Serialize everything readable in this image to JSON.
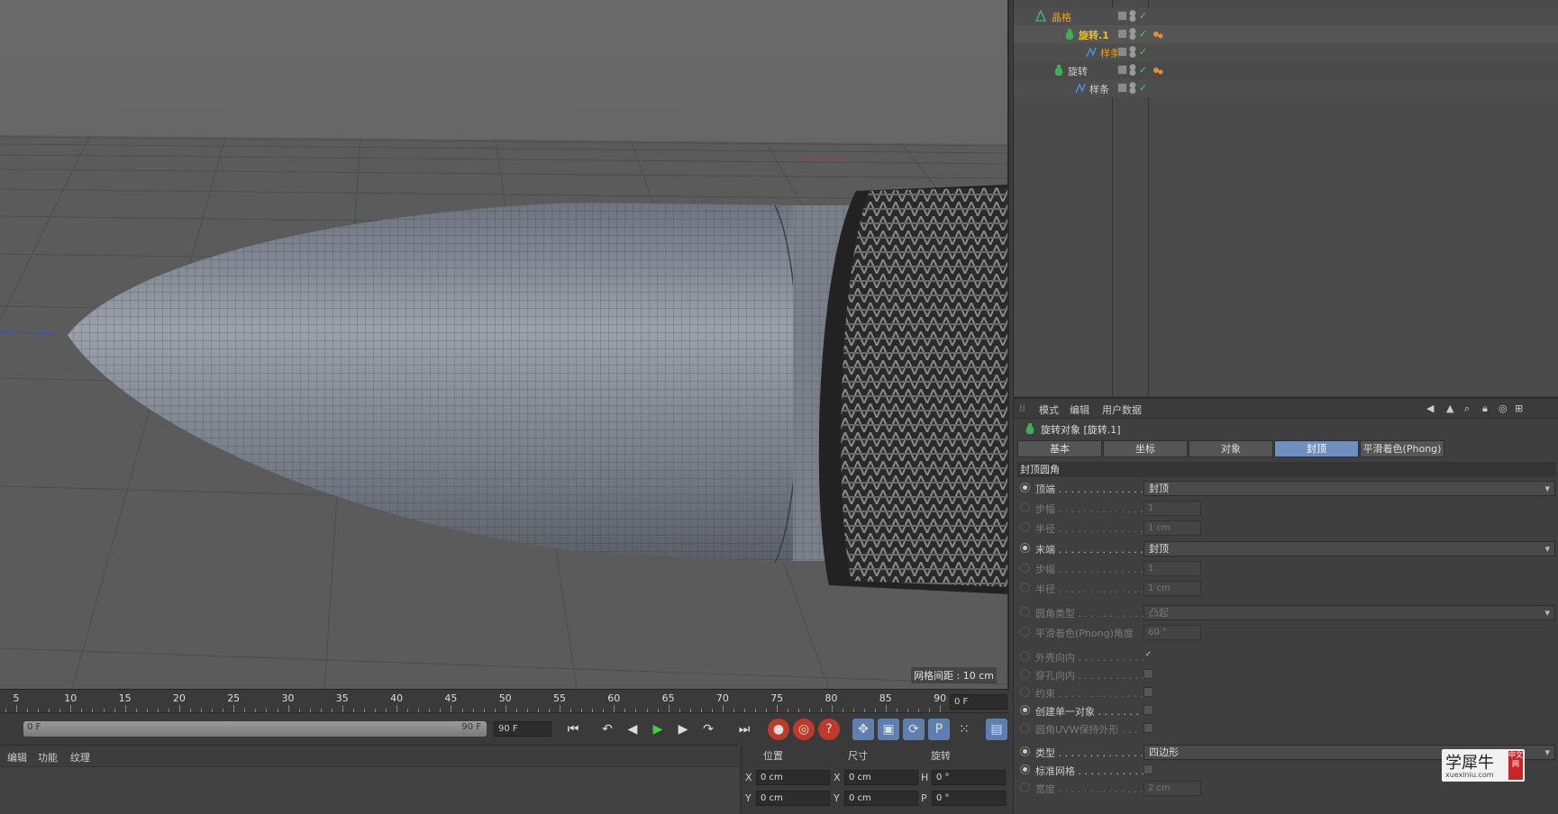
{
  "viewport": {
    "grid_spacing_label": "网格间距 : 10 cm"
  },
  "timeline": {
    "ticks": [
      "5",
      "10",
      "15",
      "20",
      "25",
      "30",
      "35",
      "40",
      "45",
      "50",
      "55",
      "60",
      "65",
      "70",
      "75",
      "80",
      "85",
      "90"
    ],
    "current_frame": "0 F",
    "scrub_start": "0 F",
    "scrub_end": "90 F",
    "end_frame": "90 F"
  },
  "transport_icons": [
    "go-start-icon",
    "prev-key-icon",
    "step-back-icon",
    "play-icon",
    "step-forward-icon",
    "next-key-icon",
    "go-end-icon",
    "record-icon",
    "auto-key-icon",
    "key-help-icon",
    "move-key-icon",
    "scale-key-icon",
    "rotate-key-icon",
    "param-key-icon",
    "point-level-icon",
    "film-icon"
  ],
  "bottom_menu": {
    "edit": "编辑",
    "function": "功能",
    "texture": "纹理"
  },
  "coords": {
    "position_hdr": "位置",
    "size_hdr": "尺寸",
    "rotation_hdr": "旋转",
    "x_label": "X",
    "y_label": "Y",
    "h_label": "H",
    "p_label": "P",
    "pos_x": "0 cm",
    "pos_y": "0 cm",
    "size_x": "0 cm",
    "size_y": "0 cm",
    "rot_h": "0 °",
    "rot_p": "0 °"
  },
  "object_manager": {
    "rows": [
      {
        "name": "晶格",
        "color": "#e8a020"
      },
      {
        "name": "旋转.1",
        "color": "#f0c020"
      },
      {
        "name": "样条",
        "color": "#e8a020"
      },
      {
        "name": "旋转",
        "color": "#d0d0d0"
      },
      {
        "name": "样条",
        "color": "#d0d0d0"
      }
    ]
  },
  "attributes": {
    "menu_mode": "模式",
    "menu_edit": "编辑",
    "menu_userdata": "用户数据",
    "object_title": "旋转对象 [旋转.1]",
    "tabs": [
      "基本",
      "坐标",
      "对象",
      "封顶",
      "平滑着色(Phong)"
    ],
    "active_tab": "封顶",
    "section": "封顶圆角",
    "rows": {
      "start": {
        "label": "顶端 . . . . . . . . . . . . . .",
        "value": "封顶"
      },
      "start_steps": {
        "label": "步幅 . . . . . . . . . . . . . .",
        "value": "1"
      },
      "start_radius": {
        "label": "半径 . . . . . . . . . . . . . .",
        "value": "1 cm"
      },
      "end": {
        "label": "末端 . . . . . . . . . . . . . .",
        "value": "封顶"
      },
      "end_steps": {
        "label": "步幅 . . . . . . . . . . . . . .",
        "value": "1"
      },
      "end_radius": {
        "label": "半径 . . . . . . . . . . . . . .",
        "value": "1 cm"
      },
      "fillet_type": {
        "label": "圆角类型 . . . . . . . . . . .",
        "value": "凸起"
      },
      "phong_angle": {
        "label": "平滑着色(Phong)角度",
        "value": "60 °"
      },
      "hull_inward": {
        "label": "外壳向内 . . . . . . . . . . .",
        "checked": "✓"
      },
      "hole_inward": {
        "label": "穿孔向内 . . . . . . . . . . ."
      },
      "constrain": {
        "label": "约束 . . . . . . . . . . . . . ."
      },
      "single_object": {
        "label": "创建单一对象 . . . . . . ."
      },
      "uvw_keep": {
        "label": "圆角UVW保持外形 . . ."
      },
      "type": {
        "label": "类型 . . . . . . . . . . . . . .",
        "value": "四边形"
      },
      "std_grid": {
        "label": "标准网格 . . . . . . . . . . ."
      },
      "width": {
        "label": "宽度 . . . . . . . . . . . . . .",
        "value": "2 cm"
      }
    }
  },
  "watermark": {
    "brand": "学犀牛",
    "url": "xuexiniu.com",
    "seal": "中文网"
  }
}
